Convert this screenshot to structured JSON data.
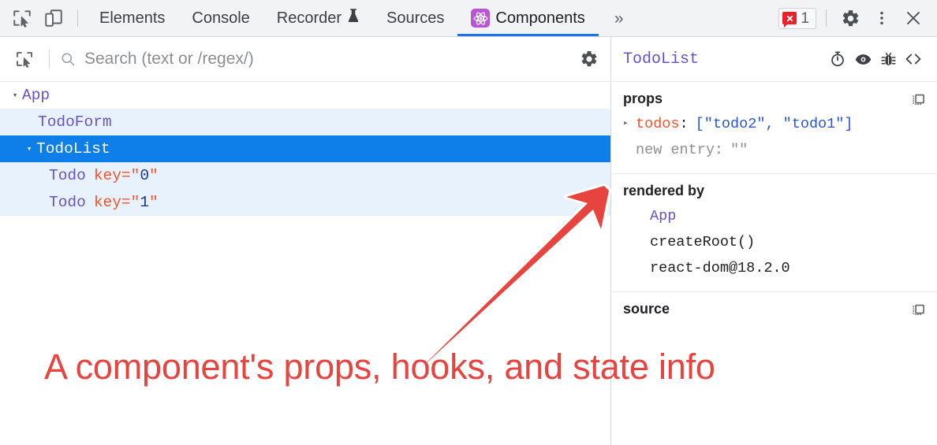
{
  "toolbar": {
    "inspect_icon": "inspect-element-icon",
    "device_icon": "device-toolbar-icon",
    "tabs": [
      {
        "label": "Elements",
        "active": false
      },
      {
        "label": "Console",
        "active": false
      },
      {
        "label": "Recorder",
        "active": false,
        "badge_icon": "flask-icon"
      },
      {
        "label": "Sources",
        "active": false
      },
      {
        "label": "Components",
        "active": true,
        "icon": "react-components-icon"
      }
    ],
    "overflow_label": "»",
    "error_badge": {
      "icon": "error-bubble-icon",
      "count": "1"
    },
    "settings_icon": "gear-icon",
    "more_icon": "kebab-menu-icon",
    "close_icon": "close-icon"
  },
  "search": {
    "pick_icon": "select-element-icon",
    "icon": "search-icon",
    "placeholder": "Search (text or /regex/)",
    "value": "",
    "settings_icon": "gear-icon"
  },
  "tree": {
    "rows": [
      {
        "name": "App",
        "arrow": "▾",
        "indent": 0,
        "state": "normal",
        "attr_key": "",
        "attr_value": ""
      },
      {
        "name": "TodoForm",
        "arrow": "",
        "indent": 20,
        "state": "shade",
        "attr_key": "",
        "attr_value": ""
      },
      {
        "name": "TodoList",
        "arrow": "▾",
        "indent": 18,
        "state": "selected",
        "attr_key": "",
        "attr_value": ""
      },
      {
        "name": "Todo",
        "arrow": "",
        "indent": 52,
        "state": "shade",
        "attr_key": "key",
        "attr_value": "0"
      },
      {
        "name": "Todo",
        "arrow": "",
        "indent": 52,
        "state": "shade",
        "attr_key": "key",
        "attr_value": "1"
      }
    ]
  },
  "inspector": {
    "title": "TodoList",
    "header_icons": [
      "stopwatch-icon",
      "eye-icon",
      "bug-icon",
      "code-brackets-icon"
    ],
    "props": {
      "title": "props",
      "copy_icon": "copy-to-clipboard-icon",
      "rows": [
        {
          "triangle": "▸",
          "name": "todos",
          "colon": ":",
          "value": "[\"todo2\", \"todo1\"]",
          "dim": false
        },
        {
          "triangle": "",
          "name": "new entry",
          "colon": ":",
          "value": "\"\"",
          "dim": true
        }
      ]
    },
    "rendered_by": {
      "title": "rendered by",
      "rows": [
        {
          "text": "App",
          "style": "purple"
        },
        {
          "text": "createRoot()",
          "style": "dark"
        },
        {
          "text": "react-dom@18.2.0",
          "style": "dark"
        }
      ]
    },
    "source": {
      "title": "source",
      "copy_icon": "copy-to-clipboard-icon"
    }
  },
  "annotation": {
    "text": "A component's props, hooks, and state info",
    "color": "#e8443f",
    "arrow_icon": "red-arrow-icon"
  }
}
